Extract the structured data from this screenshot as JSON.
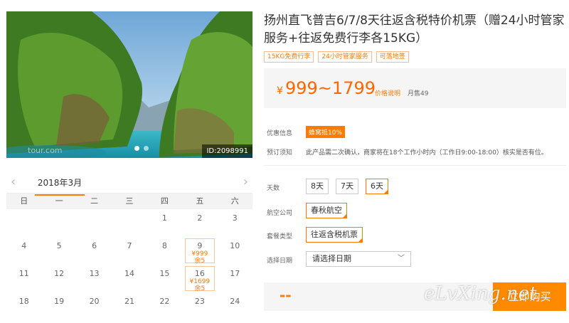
{
  "product": {
    "title": "扬州直飞普吉6/7/8天往返含税特价机票（赠24小时管家服务+往返免费行李各15KG）",
    "tags": [
      "15KG免费行李",
      "24小时管家服务",
      "可落地签"
    ],
    "image_id": "ID:2098991",
    "image_watermark": "tour.com"
  },
  "price": {
    "currency": "¥",
    "range": "999~1799",
    "explain_label": "价格说明",
    "sold_label": "月售49"
  },
  "info": {
    "promo_label": "优惠信息",
    "promo_badge": "蜂窝抵10%",
    "notice_label": "预订须知",
    "notice_text": "此产品需二次确认，商家将在18个工作小时内（工作日9:00-18:00）核实是否有位。"
  },
  "options": {
    "days_label": "天数",
    "days": [
      "8天",
      "7天",
      "6天"
    ],
    "days_selected": "6天",
    "airline_label": "航空公司",
    "airline": "春秋航空",
    "package_label": "套餐类型",
    "package": "往返含税机票",
    "date_label": "选择日期",
    "date_placeholder": "请选择日期"
  },
  "buy": {
    "price_placeholder": "--",
    "button_label": "立即购买",
    "watermark": "eLvXing.net"
  },
  "calendar": {
    "month": "2018年3月",
    "weekdays": [
      "日",
      "一",
      "二",
      "三",
      "四",
      "五",
      "六"
    ],
    "rows": [
      [
        {
          "d": ""
        },
        {
          "d": ""
        },
        {
          "d": ""
        },
        {
          "d": ""
        },
        {
          "d": "1"
        },
        {
          "d": "2"
        },
        {
          "d": "3"
        }
      ],
      [
        {
          "d": "4"
        },
        {
          "d": "5"
        },
        {
          "d": "6"
        },
        {
          "d": "7"
        },
        {
          "d": "8"
        },
        {
          "d": "9",
          "price": "¥999",
          "stock": "余5"
        },
        {
          "d": "10"
        }
      ],
      [
        {
          "d": "11"
        },
        {
          "d": "12"
        },
        {
          "d": "13"
        },
        {
          "d": "14"
        },
        {
          "d": "15"
        },
        {
          "d": "16",
          "price": "¥1699",
          "stock": "余5"
        },
        {
          "d": "17"
        }
      ],
      [
        {
          "d": "18"
        },
        {
          "d": "19"
        },
        {
          "d": "20"
        },
        {
          "d": "21"
        },
        {
          "d": "22"
        },
        {
          "d": "23"
        },
        {
          "d": "24"
        }
      ]
    ]
  },
  "colors": {
    "accent": "#ff7a00",
    "button": "#ff8a00"
  }
}
